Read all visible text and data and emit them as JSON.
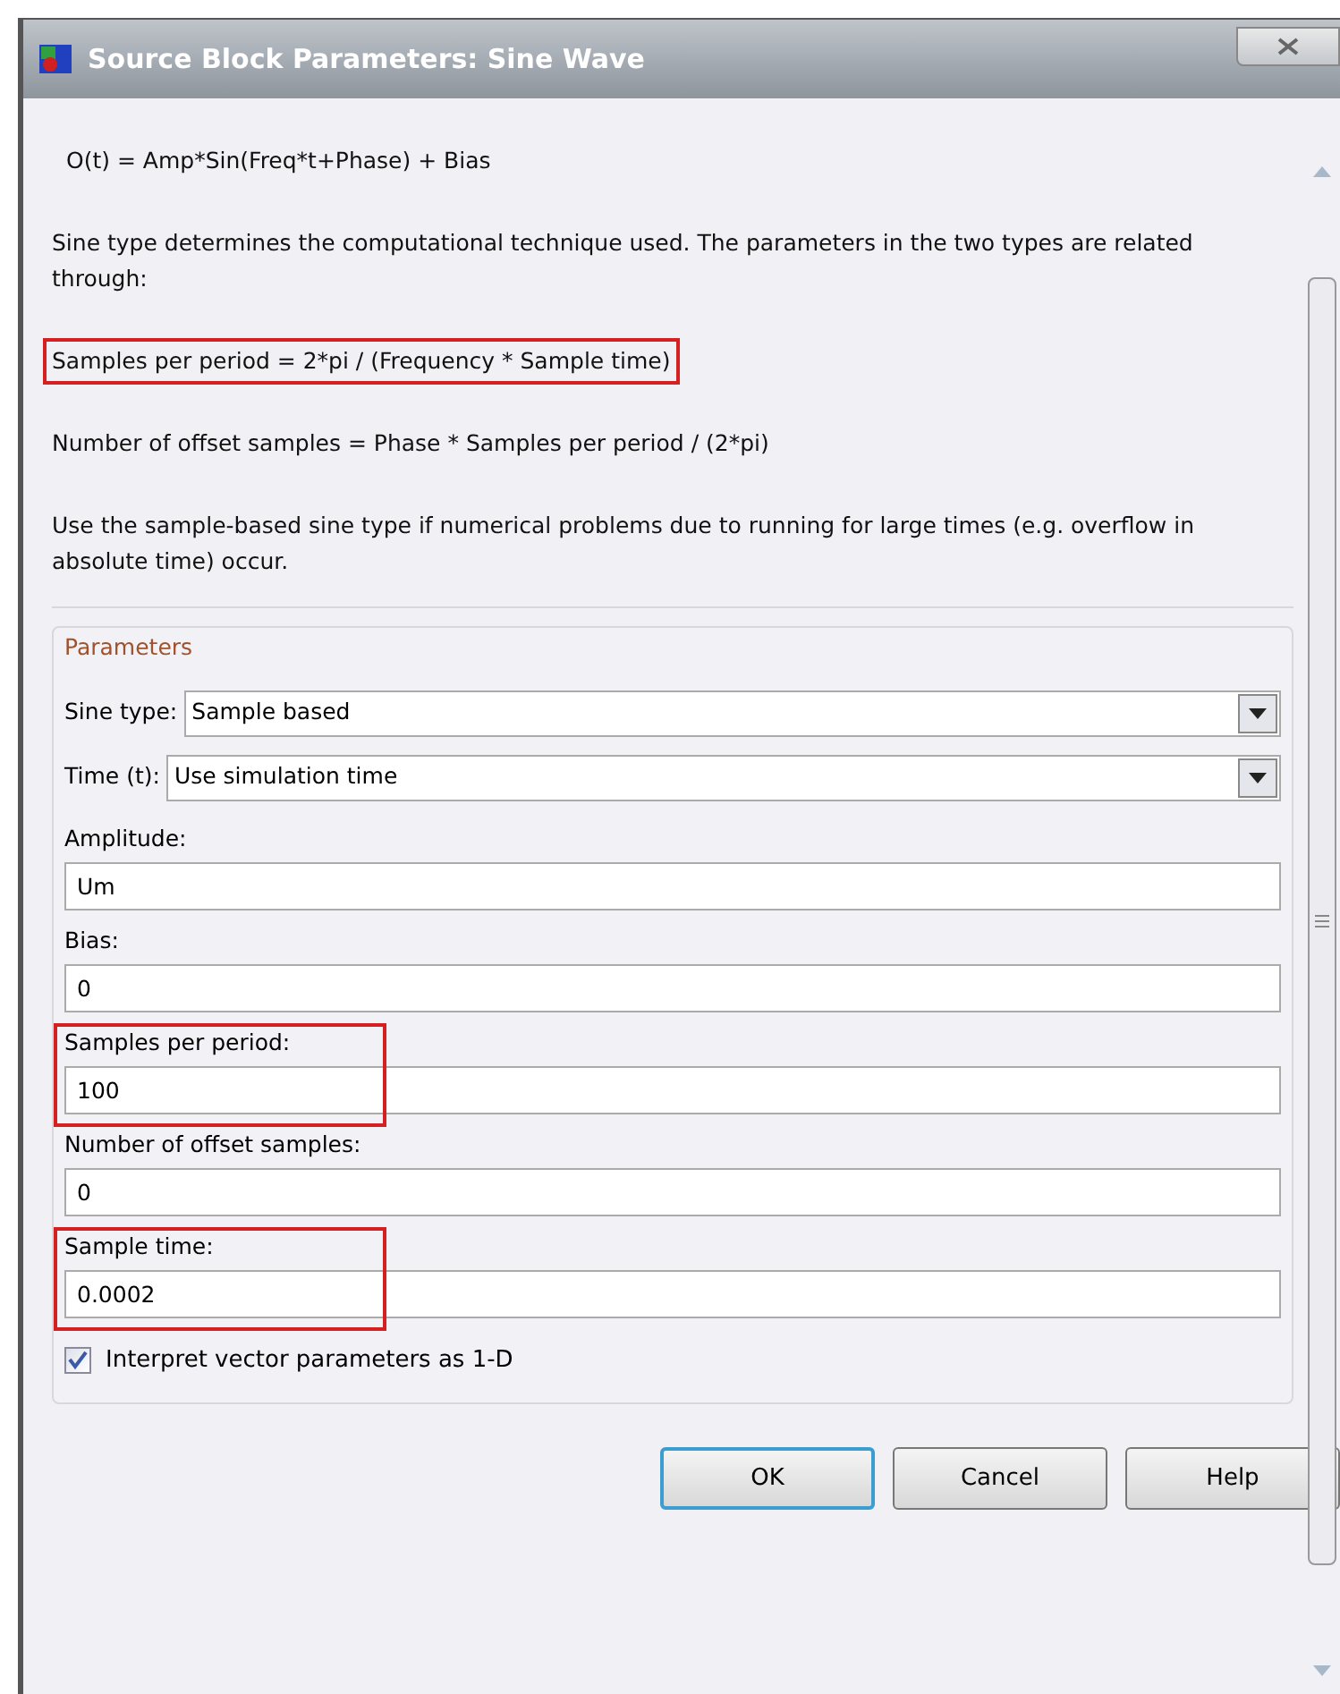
{
  "window": {
    "title": "Source Block Parameters: Sine Wave"
  },
  "description": [
    {
      "text": "O(t) = Amp*Sin(Freq*t+Phase) + Bias",
      "highlighted": false
    },
    {
      "text": "Sine type determines the computational technique used. The parameters in the two types are related through:",
      "highlighted": false
    },
    {
      "text": "Samples per period = 2*pi / (Frequency * Sample time)",
      "highlighted": true
    },
    {
      "text": "Number of offset samples = Phase * Samples per period / (2*pi)",
      "highlighted": false
    },
    {
      "text": "Use the sample-based sine type if numerical problems due to running for large times (e.g. overflow in absolute time) occur.",
      "highlighted": false
    }
  ],
  "parameters": {
    "title": "Parameters",
    "items": [
      {
        "kind": "dropdown",
        "label": "Sine type:",
        "value": "Sample based"
      },
      {
        "kind": "dropdown",
        "label": "Time (t):",
        "value": "Use simulation time"
      },
      {
        "kind": "field",
        "label": "Amplitude:",
        "value": "Um",
        "highlighted": false
      },
      {
        "kind": "field",
        "label": "Bias:",
        "value": "0",
        "highlighted": false
      },
      {
        "kind": "field",
        "label": "Samples per period:",
        "value": "100",
        "highlighted": true
      },
      {
        "kind": "field",
        "label": "Number of offset samples:",
        "value": "0",
        "highlighted": false
      },
      {
        "kind": "field",
        "label": "Sample time:",
        "value": "0.0002",
        "highlighted": true
      },
      {
        "kind": "checkbox",
        "label": "Interpret vector parameters as 1-D",
        "checked": true
      }
    ]
  },
  "buttons": [
    {
      "label": "OK",
      "default": true
    },
    {
      "label": "Cancel",
      "default": false
    },
    {
      "label": "Help",
      "default": false
    }
  ]
}
